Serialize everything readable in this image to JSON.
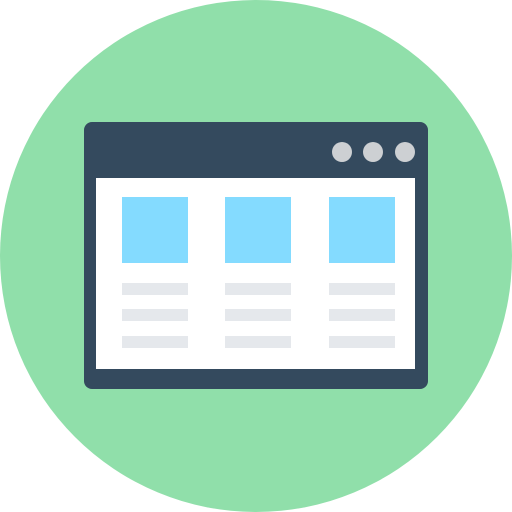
{
  "icon": {
    "name": "browser-window-grid-icon",
    "colors": {
      "background_circle": "#90dfaa",
      "window_frame": "#344a5e",
      "window_dots": "#cdd0d3",
      "content_area": "#ffffff",
      "thumbnail": "#84dbff",
      "text_line": "#e5e8ec"
    },
    "window_control_count": 3,
    "card_count": 3,
    "lines_per_card": 3
  }
}
